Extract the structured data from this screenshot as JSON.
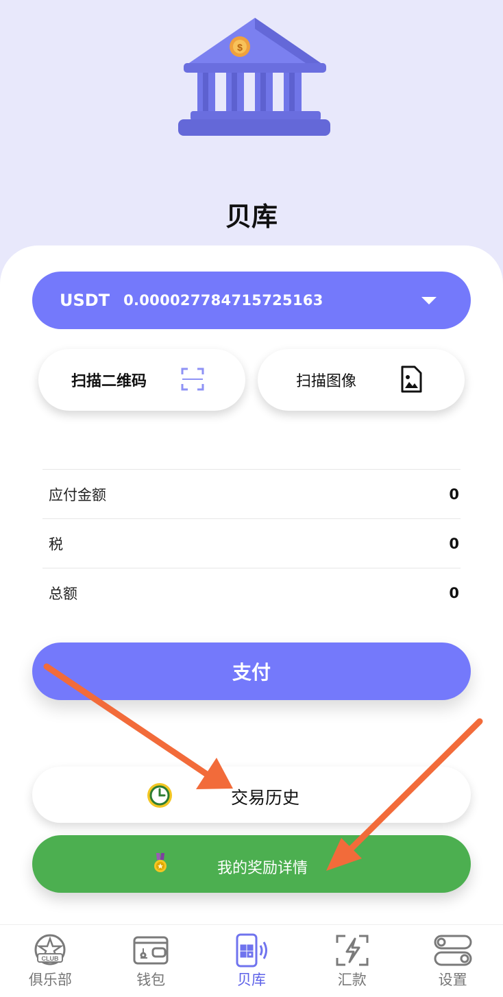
{
  "header": {
    "title": "贝库"
  },
  "currency": {
    "code": "USDT",
    "amount": "0.000027784715725163"
  },
  "scan": {
    "qr_label": "扫描二维码",
    "image_label": "扫描图像"
  },
  "summary": [
    {
      "label": "应付金额",
      "value": "0"
    },
    {
      "label": "税",
      "value": "0"
    },
    {
      "label": "总额",
      "value": "0"
    }
  ],
  "actions": {
    "pay_label": "支付",
    "history_label": "交易历史",
    "rewards_label": "我的奖励详情"
  },
  "tabs": [
    {
      "label": "俱乐部",
      "icon": "club-icon",
      "active": false
    },
    {
      "label": "钱包",
      "icon": "wallet-icon",
      "active": false
    },
    {
      "label": "贝库",
      "icon": "qr-phone-icon",
      "active": true
    },
    {
      "label": "汇款",
      "icon": "lightning-icon",
      "active": false
    },
    {
      "label": "设置",
      "icon": "toggle-settings-icon",
      "active": false
    }
  ],
  "colors": {
    "accent": "#7479fb",
    "green": "#4caf50",
    "arrow": "#f26b3a",
    "background": "#e8e8fb"
  }
}
